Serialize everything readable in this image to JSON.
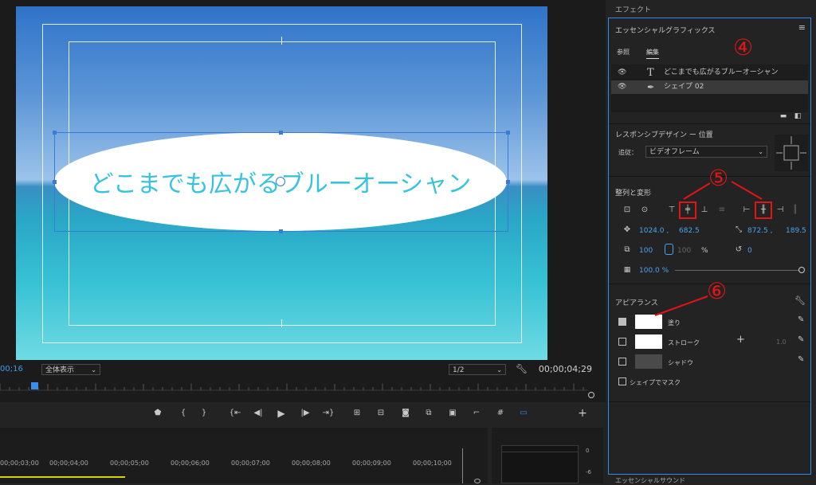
{
  "monitor": {
    "overlay_text": "どこまでも広がるブルーオーシャン",
    "timecode_current": "00;16",
    "zoom_select": "全体表示",
    "resolution_select": "1/2",
    "duration": "00;00;04;29"
  },
  "timeline": {
    "ticks": [
      "00;00;03;00",
      "00;00;04;00",
      "00;00;05;00",
      "00;00;06;00",
      "00;00;07;00",
      "00;00;08;00",
      "00;00;09;00",
      "00;00;10;00"
    ],
    "meter_labels": [
      "0",
      "-6"
    ]
  },
  "right_panel": {
    "effects_tab": "エフェクト",
    "panel_title": "エッセンシャルグラフィックス",
    "tab_browse": "参照",
    "tab_edit": "編集",
    "layers": [
      {
        "icon": "T",
        "name": "どこまでも広がるブルーオーシャン"
      },
      {
        "icon": "pen",
        "name": "シェイプ 02"
      }
    ],
    "responsive": {
      "title": "レスポンシブデザイン ー 位置",
      "pin_label": "追従：",
      "pin_value": "ビデオフレーム"
    },
    "align": {
      "title": "整列と変形",
      "position_x": "1024.0 ,",
      "position_y": "682.5",
      "anchor_x": "872.5 ,",
      "anchor_y": "189.5",
      "scale": "100",
      "scale2": "100",
      "percent": "%",
      "rotation": "0",
      "opacity": "100.0 %"
    },
    "appearance": {
      "title": "アピアランス",
      "fill_label": "塗り",
      "stroke_label": "ストローク",
      "stroke_width": "1.0",
      "shadow_label": "シャドウ",
      "mask_label": "シェイプでマスク"
    },
    "bottom_tab": "エッセンシャルサウンド"
  },
  "annotations": {
    "a4": "④",
    "a5": "⑤",
    "a6": "⑥"
  },
  "colors": {
    "accent_blue": "#2d8ceb",
    "annotation_red": "#e01515",
    "text_cyan": "#38c3dc"
  }
}
